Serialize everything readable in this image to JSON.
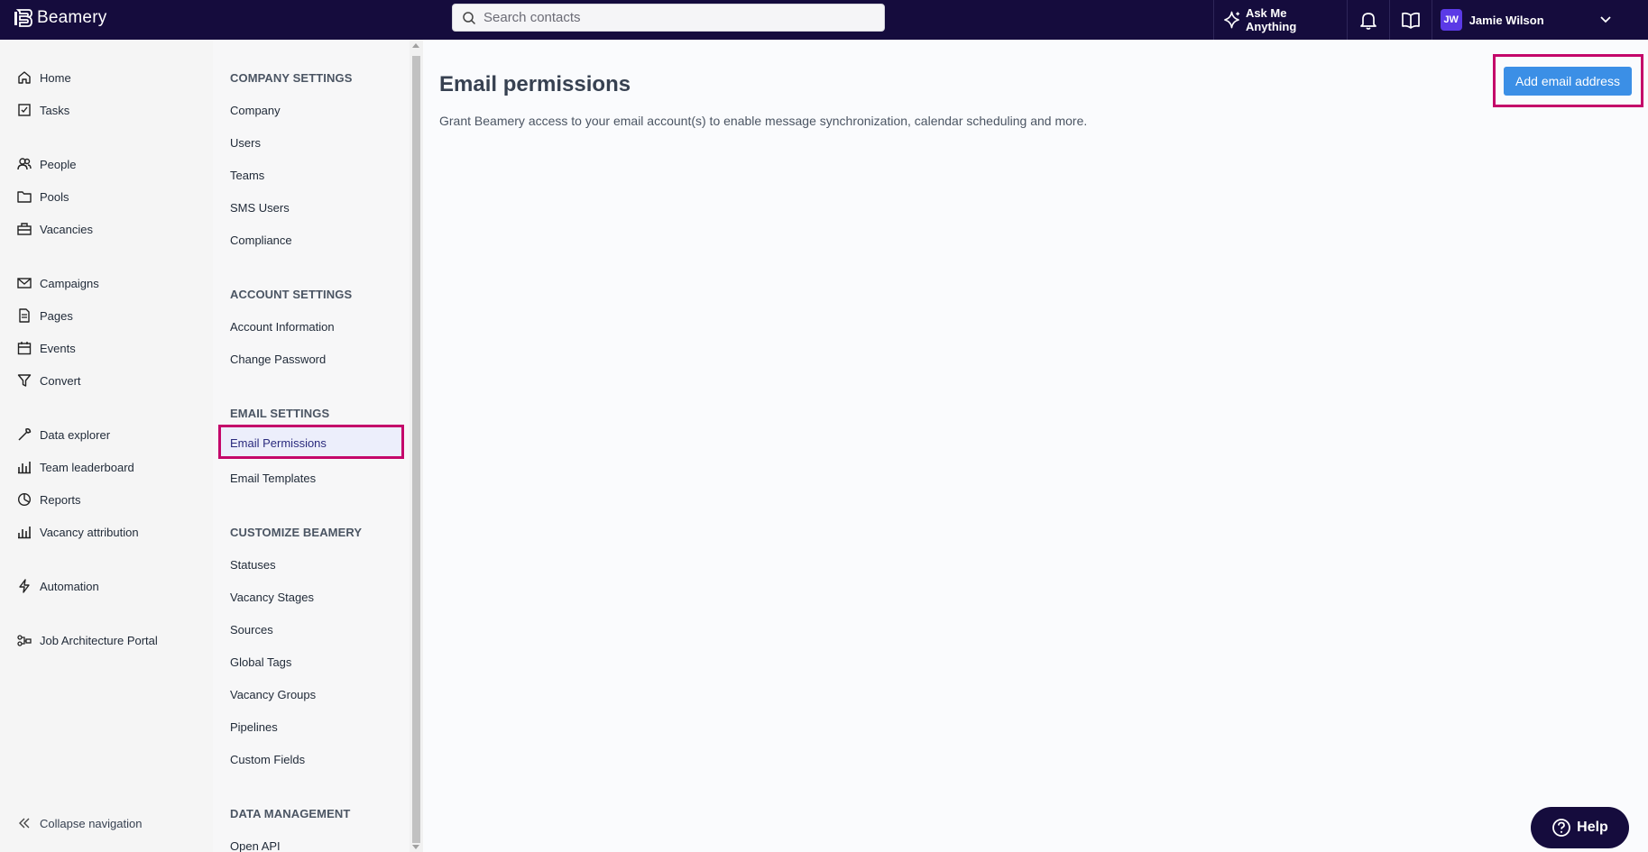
{
  "topbar": {
    "logo_text": "Beamery",
    "search_placeholder": "Search contacts",
    "ask_label": "Ask Me Anything",
    "user_initials": "JW",
    "user_name": "Jamie Wilson"
  },
  "leftnav": {
    "items": [
      {
        "label": "Home",
        "icon": "home-icon"
      },
      {
        "label": "Tasks",
        "icon": "tasks-icon"
      },
      {
        "label": "People",
        "icon": "people-icon"
      },
      {
        "label": "Pools",
        "icon": "folder-icon"
      },
      {
        "label": "Vacancies",
        "icon": "briefcase-icon"
      },
      {
        "label": "Campaigns",
        "icon": "mail-icon"
      },
      {
        "label": "Pages",
        "icon": "page-icon"
      },
      {
        "label": "Events",
        "icon": "calendar-icon"
      },
      {
        "label": "Convert",
        "icon": "filter-icon"
      },
      {
        "label": "Data explorer",
        "icon": "wrench-icon"
      },
      {
        "label": "Team leaderboard",
        "icon": "bar-chart-icon"
      },
      {
        "label": "Reports",
        "icon": "pie-chart-icon"
      },
      {
        "label": "Vacancy attribution",
        "icon": "bar-chart-icon"
      },
      {
        "label": "Automation",
        "icon": "lightning-icon"
      },
      {
        "label": "Job Architecture Portal",
        "icon": "hierarchy-icon"
      }
    ],
    "collapse_label": "Collapse navigation"
  },
  "settings": {
    "company_heading": "COMPANY SETTINGS",
    "company_items": [
      "Company",
      "Users",
      "Teams",
      "SMS Users",
      "Compliance"
    ],
    "account_heading": "ACCOUNT SETTINGS",
    "account_items": [
      "Account Information",
      "Change Password"
    ],
    "email_heading": "EMAIL SETTINGS",
    "email_items": [
      "Email Permissions",
      "Email Templates"
    ],
    "customize_heading": "CUSTOMIZE BEAMERY",
    "customize_items": [
      "Statuses",
      "Vacancy Stages",
      "Sources",
      "Global Tags",
      "Vacancy Groups",
      "Pipelines",
      "Custom Fields"
    ],
    "data_heading": "DATA MANAGEMENT",
    "data_items": [
      "Open API"
    ]
  },
  "main": {
    "title": "Email permissions",
    "description": "Grant Beamery access to your email account(s) to enable message synchronization, calendar scheduling and more.",
    "add_button": "Add email address"
  },
  "help_label": "Help",
  "colors": {
    "topbar": "#150c3d",
    "accent_blue": "#3b8fe6",
    "highlight": "#c4076a"
  }
}
